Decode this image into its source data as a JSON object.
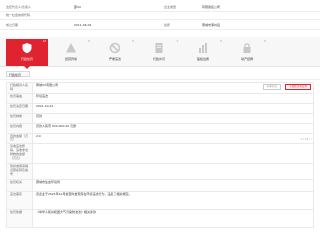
{
  "header": {
    "rows": [
      {
        "k1": "法定代表人/负责人",
        "v1": "邵XX",
        "k2": "企业类型",
        "v2": "有限责任公司"
      },
      {
        "k1": "统一社会信用代码",
        "v1": "",
        "k2": "",
        "v2": ""
      },
      {
        "k1": "成立日期",
        "v1": "2011-06-02",
        "k2": "住所",
        "v2": "晋城市泽州县"
      }
    ]
  },
  "tabs": [
    {
      "label": "行政处罚",
      "count": "13",
      "icon": "shield-icon"
    },
    {
      "label": "经营异常",
      "count": "0",
      "icon": "warning-icon"
    },
    {
      "label": "严重违法",
      "count": "0",
      "icon": "ban-icon"
    },
    {
      "label": "行政许可",
      "count": "1",
      "icon": "document-icon"
    },
    {
      "label": "股权出质",
      "count": "0",
      "icon": "chart-icon"
    },
    {
      "label": "动产抵押",
      "count": "0",
      "icon": "lock-icon"
    }
  ],
  "toolbar": {
    "back_label": "行政处罚",
    "pager": "1 / 13 ‹ ›"
  },
  "actions": {
    "download_label": "下载处罚决定书",
    "related_label": "关联信息"
  },
  "details": [
    {
      "key": "行政相对人名称",
      "value": "晋城XX有限公司"
    },
    {
      "key": "处罚事由",
      "value": "环境违法"
    },
    {
      "key": "处罚决定日期",
      "value": "2021-10-21"
    },
    {
      "key": "处罚种类",
      "value": "罚款"
    },
    {
      "key": "处罚内容",
      "value": "罚款人民币 ¥20,000.00 元整"
    },
    {
      "key": "罚款金额（万元）",
      "value": "2.0"
    },
    {
      "key": "没收违法所得、没收非法财物的金额（万元）",
      "value": ""
    },
    {
      "key": "暂扣或者吊销证照名称及编号",
      "value": ""
    },
    {
      "key": "处罚机关",
      "value": "晋城市生态环境局"
    },
    {
      "key": "违法事实",
      "value": "该企业于2021年10月检查时发现存在环境违法行为，违反了相关规定。"
    },
    {
      "key": "处罚依据",
      "value": "《中华人民共和国大气污染防治法》相关条款"
    }
  ],
  "colors": {
    "accent": "#e0242f"
  }
}
